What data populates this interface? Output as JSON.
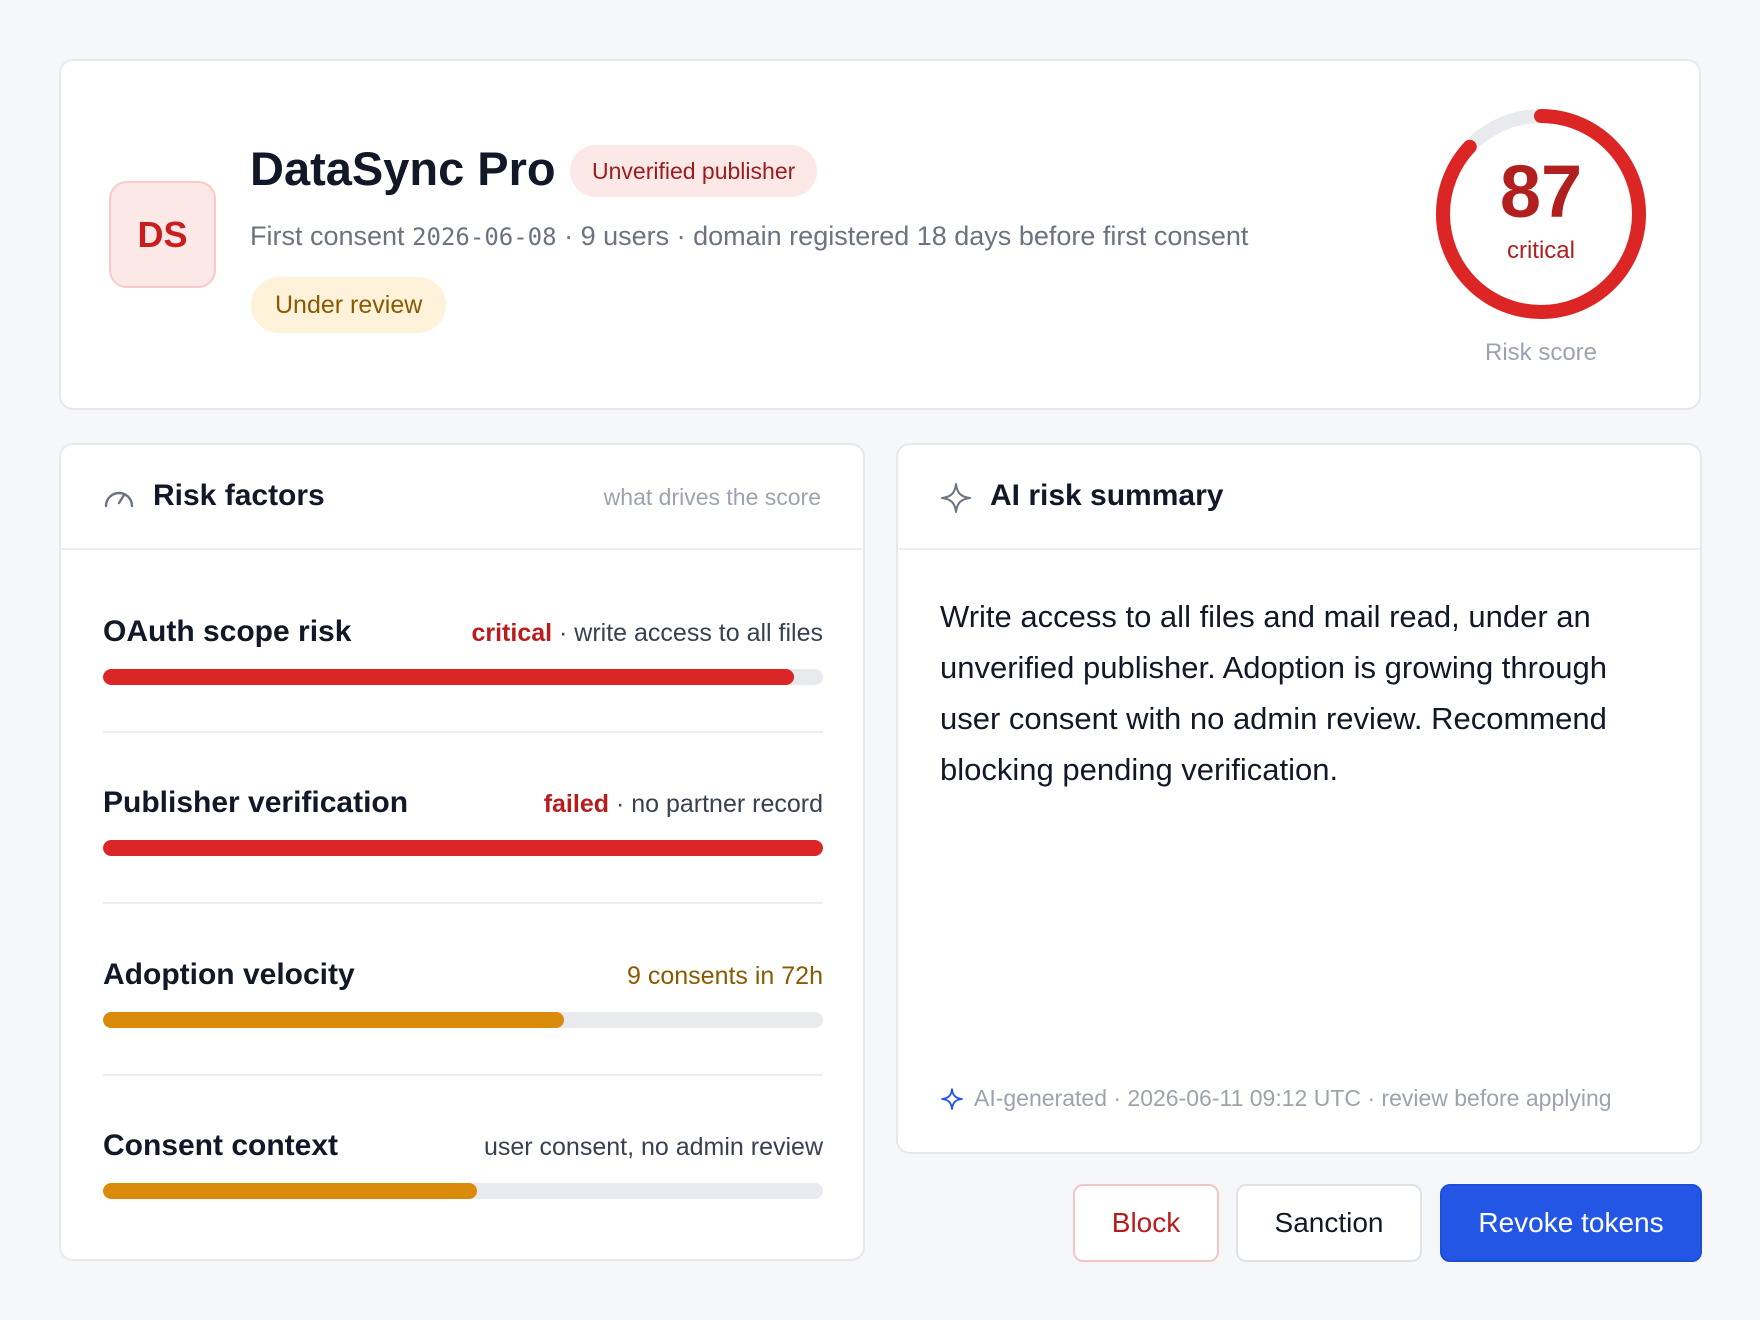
{
  "app": {
    "initials": "DS",
    "name": "DataSync Pro",
    "publisher_badge": "Unverified publisher",
    "meta": {
      "first_consent_label": "First consent",
      "first_consent_date": "2026-06-08",
      "users": "9 users",
      "domain_note": "domain registered 18 days before first consent",
      "separator": " · "
    },
    "status_badge": "Under review",
    "risk": {
      "score": "87",
      "score_value": 87,
      "score_max": 100,
      "level": "critical",
      "caption": "Risk score"
    }
  },
  "factors_panel": {
    "icon": "gauge-icon",
    "title": "Risk factors",
    "hint": "what drives the score",
    "items": [
      {
        "name": "OAuth scope risk",
        "severity": "critical",
        "detail": "write access to all files",
        "fill": 0.96,
        "color": "#dc2626",
        "severity_color": "#b91c1c"
      },
      {
        "name": "Publisher verification",
        "severity": "failed",
        "detail": "no partner record",
        "fill": 1.0,
        "color": "#dc2626",
        "severity_color": "#b91c1c"
      },
      {
        "name": "Adoption velocity",
        "severity": "9 consents in 72h",
        "detail": "",
        "fill": 0.64,
        "color": "#d98a0b",
        "severity_color": "#8a5a00"
      },
      {
        "name": "Consent context",
        "severity": "",
        "detail": "user consent, no admin review",
        "fill": 0.52,
        "color": "#d98a0b",
        "severity_color": "#374151"
      }
    ]
  },
  "summary_panel": {
    "icon": "sparkle-icon",
    "title": "AI risk summary",
    "body": "Write access to all files and mail read, under an unverified publisher. Adoption is growing through user consent with no admin review. Recommend blocking pending verification.",
    "footer": "AI-generated · 2026-06-11 09:12 UTC · review before applying"
  },
  "actions": {
    "block": "Block",
    "sanction": "Sanction",
    "revoke": "Revoke tokens"
  },
  "colors": {
    "critical": "#dc2626",
    "warning": "#d98a0b",
    "primary": "#2456e6"
  }
}
